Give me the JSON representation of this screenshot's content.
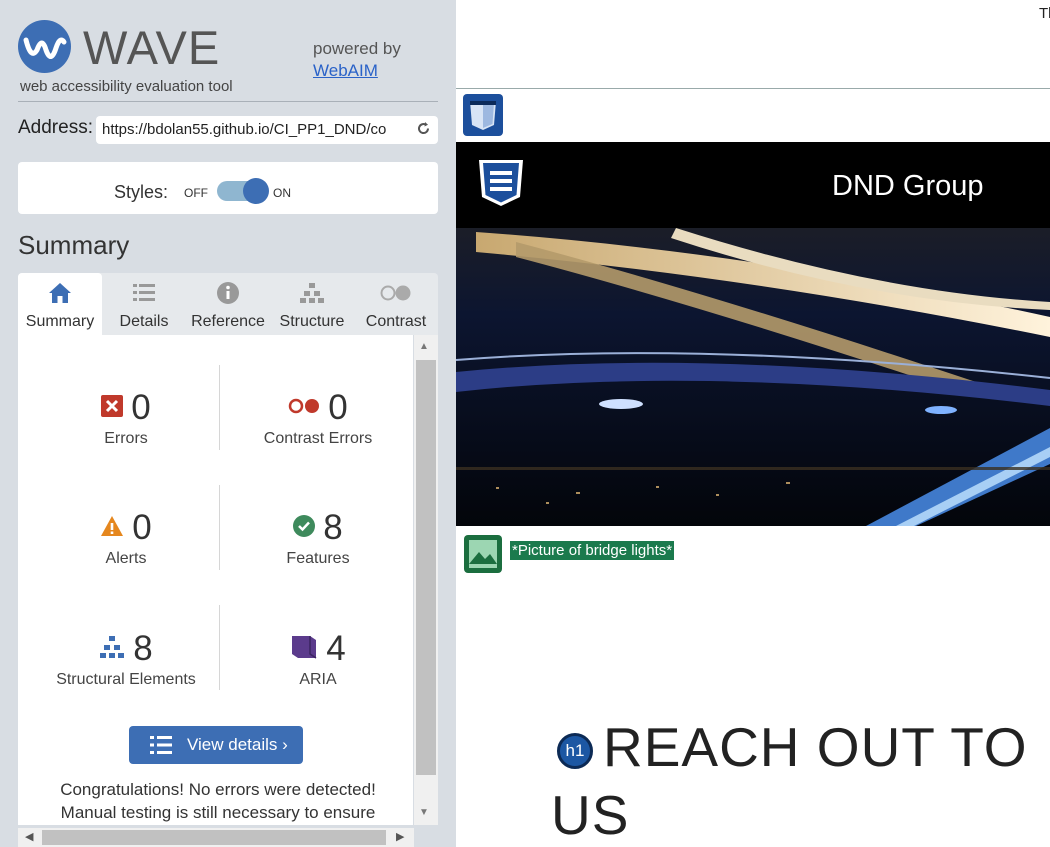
{
  "header": {
    "title": "WAVE",
    "tagline": "web accessibility evaluation tool",
    "powered_by": "powered by",
    "webaim": "WebAIM"
  },
  "address": {
    "label": "Address:",
    "value": "https://bdolan55.github.io/CI_PP1_DND/co"
  },
  "styles": {
    "label": "Styles:",
    "off": "OFF",
    "on": "ON",
    "enabled": true
  },
  "summary_heading": "Summary",
  "tabs": [
    {
      "label": "Summary",
      "icon": "home-icon",
      "active": true
    },
    {
      "label": "Details",
      "icon": "list-icon"
    },
    {
      "label": "Reference",
      "icon": "info-icon"
    },
    {
      "label": "Structure",
      "icon": "hierarchy-icon"
    },
    {
      "label": "Contrast",
      "icon": "contrast-icon"
    }
  ],
  "stats": {
    "errors": {
      "count": "0",
      "label": "Errors"
    },
    "contrast_errors": {
      "count": "0",
      "label": "Contrast Errors"
    },
    "alerts": {
      "count": "0",
      "label": "Alerts"
    },
    "features": {
      "count": "8",
      "label": "Features"
    },
    "structural": {
      "count": "8",
      "label": "Structural Elements"
    },
    "aria": {
      "count": "4",
      "label": "ARIA"
    }
  },
  "view_details": "View details ›",
  "congrats": {
    "line1": "Congratulations! No errors were detected!",
    "line2": "Manual testing is still necessary to ensure"
  },
  "page": {
    "top_text": "Tl",
    "brand": "DND Group",
    "alt_text": "*Picture of bridge lights*",
    "h1_badge": "h1",
    "heading_line1": "REACH OUT TO",
    "heading_line2": "US"
  },
  "colors": {
    "accent": "#3d6eb4",
    "error": "#c0392b",
    "alert": "#e5871e",
    "feature": "#3e8a5c",
    "aria": "#5b3b8c",
    "sidebar_bg": "#d8dde3"
  }
}
